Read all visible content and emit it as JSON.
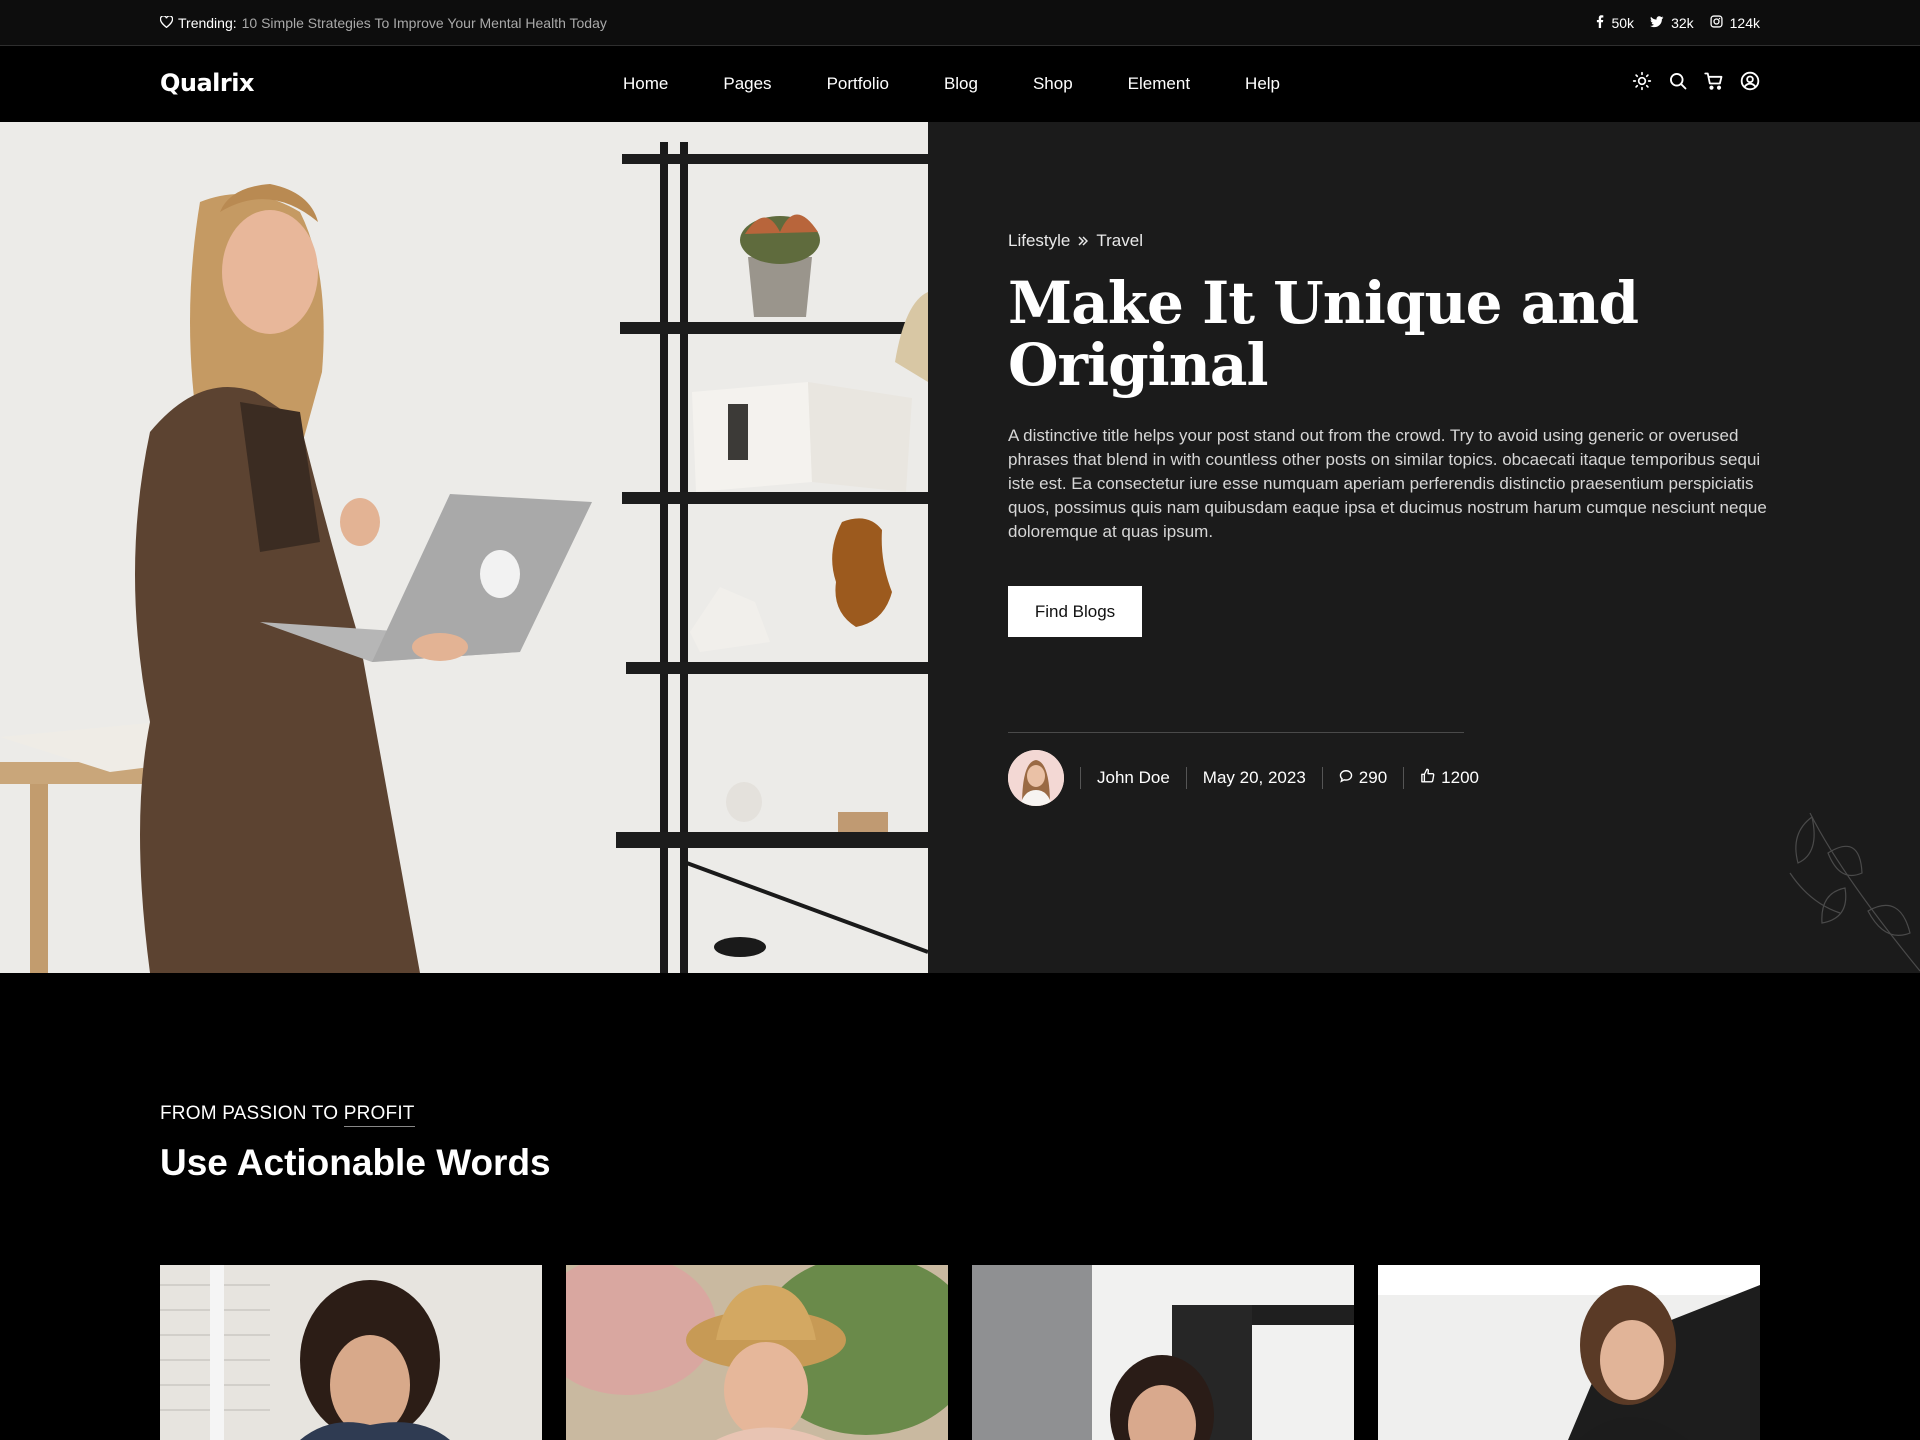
{
  "topbar": {
    "trending_label": "Trending:",
    "trending_text": "10 Simple Strategies To Improve Your Mental Health Today",
    "socials": [
      {
        "icon": "facebook-icon",
        "count": "50k"
      },
      {
        "icon": "twitter-icon",
        "count": "32k"
      },
      {
        "icon": "instagram-icon",
        "count": "124k"
      }
    ]
  },
  "nav": {
    "logo": "Qualrix",
    "menu": [
      "Home",
      "Pages",
      "Portfolio",
      "Blog",
      "Shop",
      "Element",
      "Help"
    ],
    "icons": [
      "theme-toggle-icon",
      "search-icon",
      "cart-icon",
      "user-icon"
    ]
  },
  "hero": {
    "breadcrumb": [
      "Lifestyle",
      "Travel"
    ],
    "title": "Make It Unique and Original",
    "description": "A distinctive title helps your post stand out from the crowd. Try to avoid using generic or overused phrases that blend in with countless other posts on similar topics. obcaecati itaque temporibus sequi iste est. Ea consectetur iure esse numquam aperiam perferendis distinctio praesentium perspiciatis quos, possimus quis nam quibusdam eaque ipsa et ducimus nostrum harum cumque nesciunt neque doloremque at quas ipsum.",
    "button": "Find Blogs",
    "author": "John Doe",
    "date": "May 20, 2023",
    "comments": "290",
    "likes": "1200"
  },
  "section": {
    "eyebrow_prefix": "From Passion To",
    "eyebrow_highlight": "Profit",
    "title": "Use Actionable Words"
  },
  "colors": {
    "background": "#000000",
    "panel": "#1b1b1b",
    "button_bg": "#ffffff"
  }
}
